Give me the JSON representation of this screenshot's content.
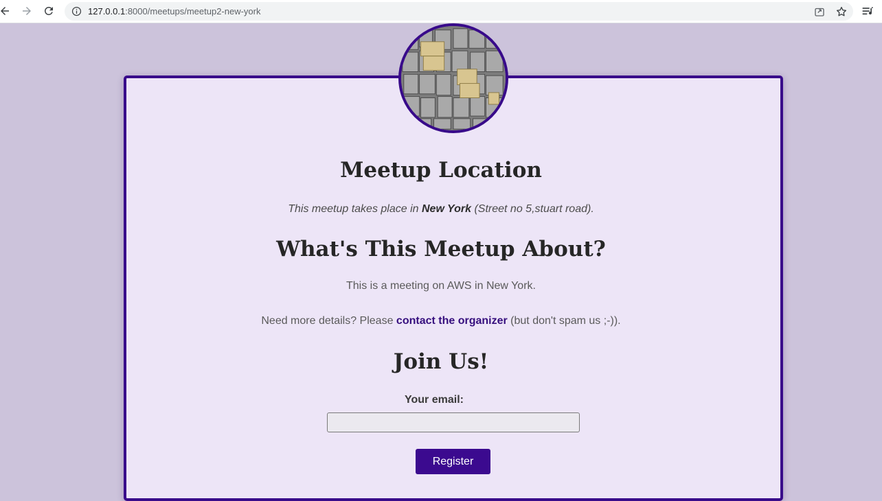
{
  "browser": {
    "url_host": "127.0.0.1",
    "url_rest": ":8000/meetups/meetup2-new-york"
  },
  "meetup": {
    "location_heading": "Meetup Location",
    "location_prefix": "This meetup takes place in ",
    "location_city": "New York",
    "location_address": " (Street no 5,stuart road).",
    "about_heading": "What's This Meetup About?",
    "description": "This is a meeting on AWS in New York.",
    "contact_prefix": "Need more details? Please ",
    "contact_link": "contact the organizer",
    "contact_suffix": " (but don't spam us ;-)).",
    "join_heading": "Join Us!",
    "email_label": "Your email:",
    "email_value": "",
    "register_label": "Register"
  },
  "colors": {
    "accent": "#380a8a",
    "card_background": "#ede5f7",
    "page_background": "#ccc3db"
  },
  "icons": {
    "back": "arrow-left-icon",
    "forward": "arrow-right-icon",
    "reload": "reload-icon",
    "site_info": "info-icon",
    "share": "share-icon",
    "bookmark": "star-icon",
    "media": "media-control-icon"
  }
}
